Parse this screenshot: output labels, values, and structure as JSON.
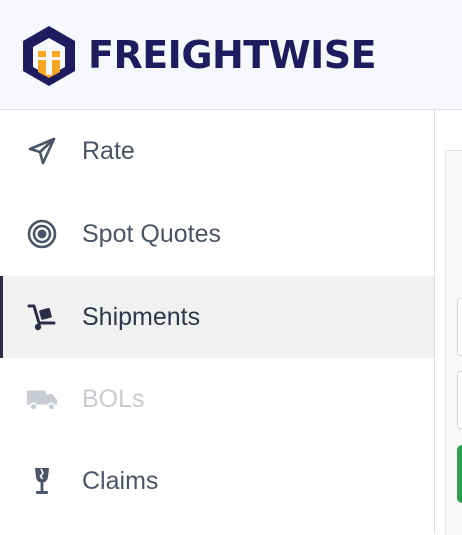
{
  "app": {
    "brand_name": "FREIGHTWISE",
    "brand_colors": {
      "navy": "#1e1b5e",
      "orange": "#f5a623"
    }
  },
  "sidebar": {
    "items": [
      {
        "id": "rate",
        "label": "Rate",
        "icon": "paper-plane-icon",
        "state": "default"
      },
      {
        "id": "spot-quotes",
        "label": "Spot Quotes",
        "icon": "target-icon",
        "state": "default"
      },
      {
        "id": "shipments",
        "label": "Shipments",
        "icon": "hand-truck-icon",
        "state": "active"
      },
      {
        "id": "bols",
        "label": "BOLs",
        "icon": "truck-icon",
        "state": "disabled"
      },
      {
        "id": "claims",
        "label": "Claims",
        "icon": "broken-glass-icon",
        "state": "default"
      }
    ]
  }
}
